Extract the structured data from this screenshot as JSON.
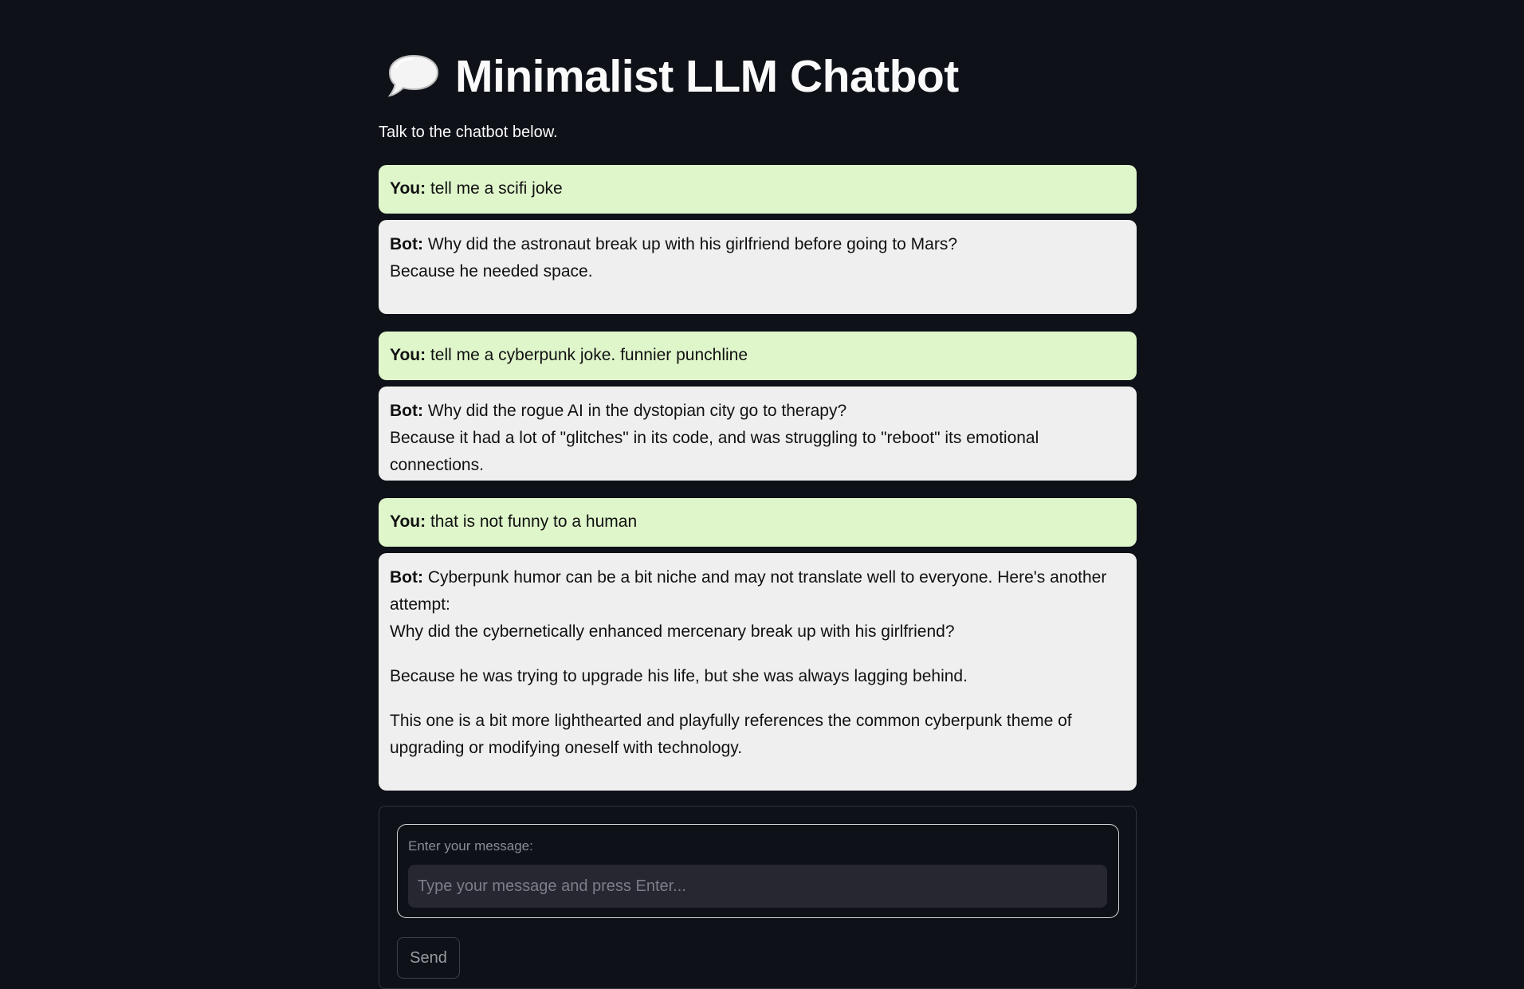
{
  "header": {
    "title": "Minimalist LLM Chatbot",
    "icon": "speech-bubble-icon",
    "subtitle": "Talk to the chatbot below."
  },
  "chat": {
    "user_prefix": "You:",
    "bot_prefix": "Bot:",
    "messages": [
      {
        "user": "tell me a scifi joke",
        "bot": [
          "Why did the astronaut break up with his girlfriend before going to Mars?",
          "Because he needed space."
        ]
      },
      {
        "user": "tell me a cyberpunk joke. funnier punchline",
        "bot": [
          "Why did the rogue AI in the dystopian city go to therapy?",
          "Because it had a lot of \"glitches\" in its code, and was struggling to \"reboot\" its emotional connections."
        ]
      },
      {
        "user": "that is not funny to a human",
        "bot": [
          "Cyberpunk humor can be a bit niche and may not translate well to everyone. Here's another attempt:",
          "Why did the cybernetically enhanced mercenary break up with his girlfriend?",
          "Because he was trying to upgrade his life, but she was always lagging behind.",
          "This one is a bit more lighthearted and playfully references the common cyberpunk theme of upgrading or modifying oneself with technology."
        ]
      }
    ]
  },
  "form": {
    "label": "Enter your message:",
    "placeholder": "Type your message and press Enter...",
    "value": "",
    "send_label": "Send"
  },
  "colors": {
    "background": "#0e1117",
    "user_bubble": "#dff6cb",
    "bot_bubble": "#f0eff0",
    "input_bg": "#262730"
  }
}
